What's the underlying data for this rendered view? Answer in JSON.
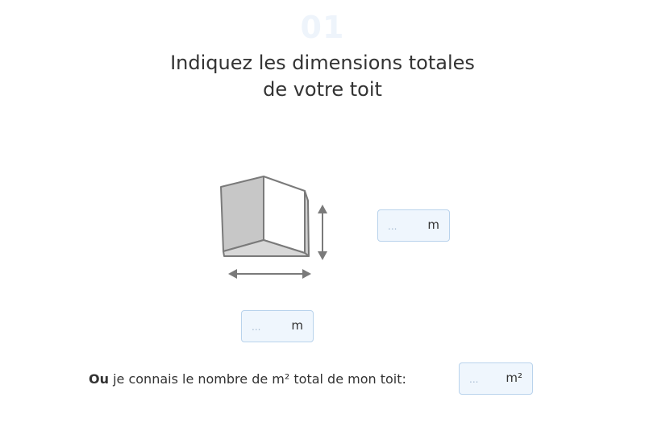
{
  "step": {
    "number": "01"
  },
  "title": {
    "line1": "Indiquez les dimensions totales",
    "line2": "de votre toit"
  },
  "height_field": {
    "placeholder": "...",
    "unit": "m"
  },
  "width_field": {
    "placeholder": "...",
    "unit": "m"
  },
  "area": {
    "or_label": "Ou",
    "label": " je connais le nombre de m² total de mon toit:",
    "field": {
      "placeholder": "...",
      "unit": "m²"
    }
  },
  "colors": {
    "field_bg": "#eff6fd",
    "field_border": "#b9d3ec",
    "step_number": "#eef4fb",
    "text": "#333333"
  },
  "icons": [
    "roof-dimensions-icon",
    "height-arrow-icon",
    "width-arrow-icon"
  ]
}
